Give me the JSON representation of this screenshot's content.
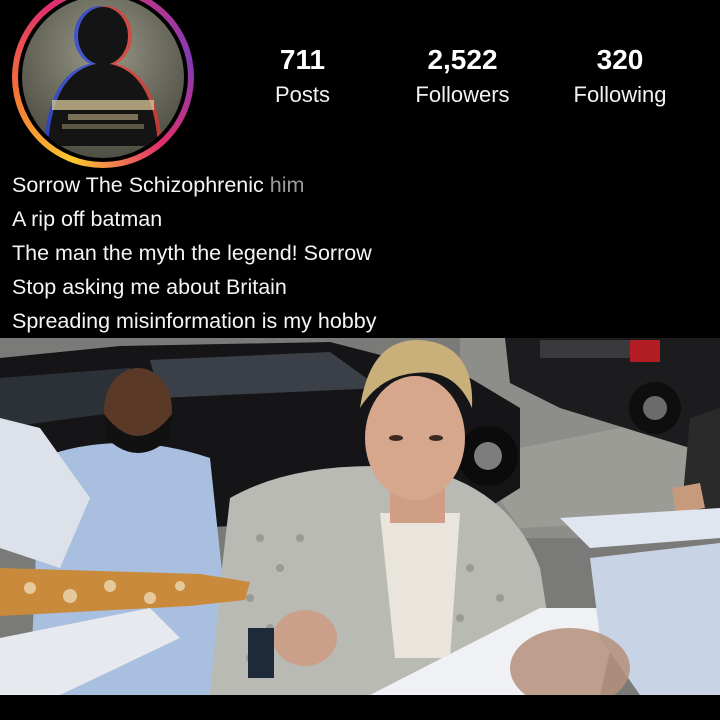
{
  "profile": {
    "name": "Sorrow The Schizophrenic",
    "pronoun": "him",
    "bio_lines": [
      "A rip off batman",
      "The man the myth the legend! Sorrow",
      "Stop asking me about Britain",
      "Spreading misinformation is my hobby"
    ]
  },
  "stats": {
    "posts": {
      "value": "711",
      "label": "Posts"
    },
    "followers": {
      "value": "2,522",
      "label": "Followers"
    },
    "following": {
      "value": "320",
      "label": "Following"
    }
  },
  "avatar": {
    "icon": "profile-picture",
    "ring_colors": [
      "#fdc830",
      "#e1306c",
      "#833ab4"
    ]
  },
  "post": {
    "icon": "photo",
    "description_hidden": true
  }
}
